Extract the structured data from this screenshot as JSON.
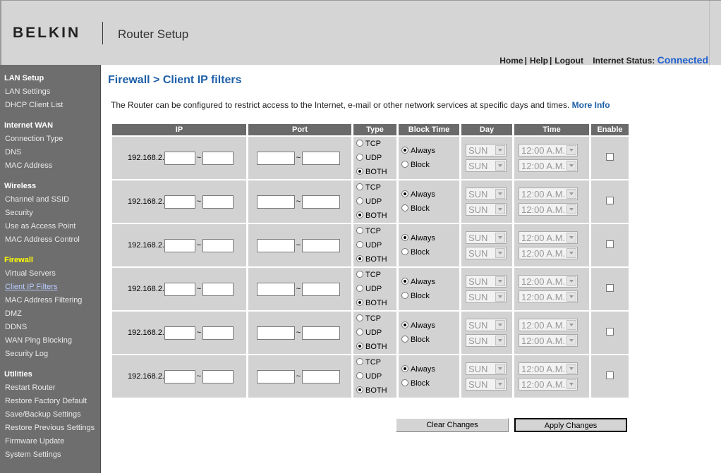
{
  "header": {
    "brand": "BELKIN",
    "app_title": "Router Setup",
    "nav": {
      "home": "Home",
      "help": "Help",
      "logout": "Logout",
      "sep": "|"
    },
    "status_label": "Internet Status:",
    "status_value": "Connected"
  },
  "sidebar": {
    "sections": [
      {
        "title": "LAN Setup",
        "items": [
          "LAN Settings",
          "DHCP Client List"
        ]
      },
      {
        "title": "Internet WAN",
        "items": [
          "Connection Type",
          "DNS",
          "MAC Address"
        ]
      },
      {
        "title": "Wireless",
        "items": [
          "Channel and SSID",
          "Security",
          "Use as Access Point",
          "MAC Address Control"
        ]
      },
      {
        "title": "Firewall",
        "items": [
          "Virtual Servers",
          "Client IP Filters",
          "MAC Address Filtering",
          "DMZ",
          "DDNS",
          "WAN Ping Blocking",
          "Security Log"
        ]
      },
      {
        "title": "Utilities",
        "items": [
          "Restart Router",
          "Restore Factory Default",
          "Save/Backup Settings",
          "Restore Previous Settings",
          "Firmware Update",
          "System Settings"
        ]
      }
    ],
    "active_section": "Firewall",
    "current_item": "Client IP Filters"
  },
  "page": {
    "title": "Firewall > Client IP filters",
    "description": "The Router can be configured to restrict access to the Internet, e-mail or other network services at specific days and times.",
    "more_info": "More Info"
  },
  "table": {
    "headers": {
      "ip": "IP",
      "port": "Port",
      "type": "Type",
      "block_time": "Block Time",
      "day": "Day",
      "time": "Time",
      "enable": "Enable"
    },
    "ip_prefix": "192.168.2.",
    "range_sep": "~",
    "type_options": {
      "tcp": "TCP",
      "udp": "UDP",
      "both": "BOTH"
    },
    "block_options": {
      "always": "Always",
      "block": "Block"
    },
    "day_value": "SUN",
    "time_value": "12:00 A.M.",
    "rows": [
      {
        "type": "BOTH",
        "block": "Always",
        "enabled": false
      },
      {
        "type": "BOTH",
        "block": "Always",
        "enabled": false
      },
      {
        "type": "BOTH",
        "block": "Always",
        "enabled": false
      },
      {
        "type": "BOTH",
        "block": "Always",
        "enabled": false
      },
      {
        "type": "BOTH",
        "block": "Always",
        "enabled": false
      },
      {
        "type": "BOTH",
        "block": "Always",
        "enabled": false
      }
    ]
  },
  "buttons": {
    "clear": "Clear Changes",
    "apply": "Apply Changes"
  }
}
